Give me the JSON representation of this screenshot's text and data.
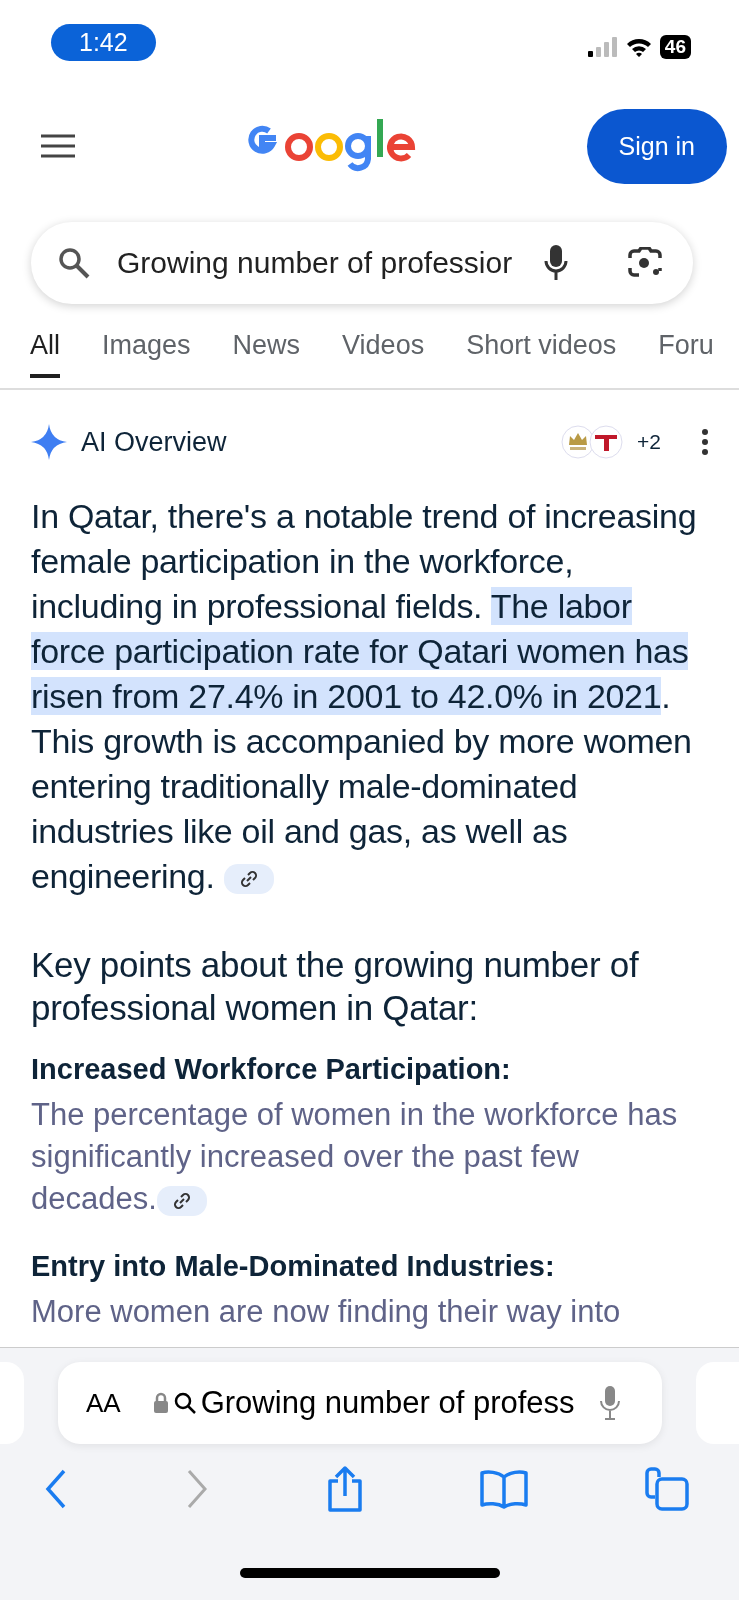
{
  "status_bar": {
    "time": "1:42",
    "battery": "46"
  },
  "header": {
    "sign_in": "Sign in"
  },
  "search": {
    "value": "Growing number of professior"
  },
  "tabs": [
    {
      "label": "All",
      "selected": true
    },
    {
      "label": "Images",
      "selected": false
    },
    {
      "label": "News",
      "selected": false
    },
    {
      "label": "Videos",
      "selected": false
    },
    {
      "label": "Short videos",
      "selected": false
    },
    {
      "label": "Foru",
      "selected": false
    }
  ],
  "ai_overview": {
    "title": "AI Overview",
    "source_count": "+2",
    "paragraph": [
      {
        "text": "In Qatar, there's a notable trend of increasing female participation in the workforce, including in professional fields. ",
        "highlighted": false
      },
      {
        "text": "The labor force participation rate for Qatari women has risen from 27.4% in 2001 to 42.0% in 2021",
        "highlighted": true
      },
      {
        "text": ". This growth is accompanied by more women entering traditionally male-dominated industries like oil and gas, as well as engineering.",
        "highlighted": false
      }
    ],
    "heading": "Key points about the growing number of professional women in Qatar:",
    "points": [
      {
        "title": "Increased Workforce Participation:",
        "text": "The percentage of women in the workforce has significantly increased over the past few decades.",
        "link": true
      },
      {
        "title": "Entry into Male-Dominated Industries:",
        "text": "More women are now finding their way into",
        "link": false
      }
    ]
  },
  "browser_bar": {
    "text_size": "AA",
    "address": "Growing number of profess"
  }
}
